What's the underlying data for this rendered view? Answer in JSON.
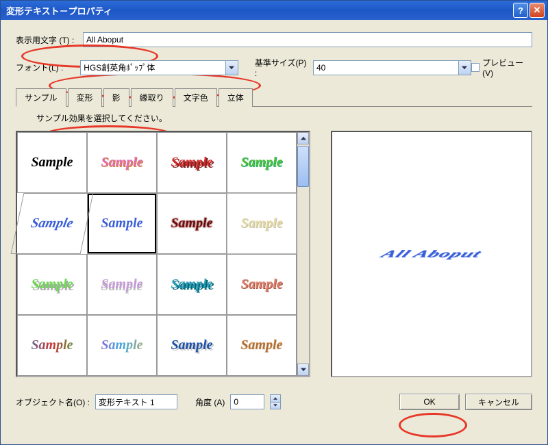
{
  "window": {
    "title": "変形テキスト－プロパティ"
  },
  "labels": {
    "display_text": "表示用文字 (T) :",
    "font": "フォント(L) :",
    "base_size": "基準サイズ(P) :",
    "preview": "プレビュー(V)",
    "object_name": "オブジェクト名(O) :",
    "angle": "角度 (A)"
  },
  "values": {
    "display_text": "All Aboput",
    "font": "HGS創英角ﾎﾟｯﾌﾟ体",
    "base_size": "40",
    "object_name": "変形テキスト 1",
    "angle": "0",
    "preview_checked": false
  },
  "tabs": {
    "items": [
      "サンプル",
      "変形",
      "影",
      "縁取り",
      "文字色",
      "立体"
    ],
    "active": 0,
    "hint": "サンプル効果を選択してください。"
  },
  "samples": {
    "selected_index": 5,
    "cells": [
      "Sample",
      "Sample",
      "Sample",
      "Sample",
      "Sample",
      "Sample",
      "Sample",
      "Sample",
      "Sample",
      "Sample",
      "Sample",
      "Sample",
      "Sample",
      "Sample",
      "Sample",
      "Sample"
    ]
  },
  "preview_text": "All Aboput",
  "buttons": {
    "ok": "OK",
    "cancel": "キャンセル"
  }
}
